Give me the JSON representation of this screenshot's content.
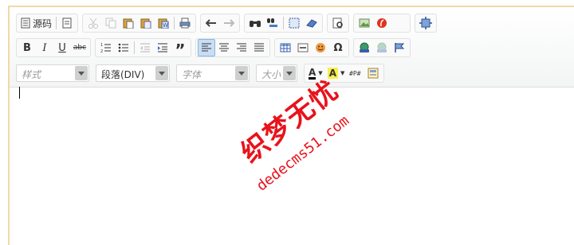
{
  "toolbar": {
    "source_label": "源码",
    "paragraph_format": "段落(DIV)",
    "style_placeholder": "样式",
    "font_placeholder": "字体",
    "size_placeholder": "大小",
    "bold": "B",
    "italic": "I",
    "underline": "U",
    "strike": "abc",
    "quote": "”",
    "omega": "Ω",
    "font_color_letter": "A",
    "bg_color_letter": "A"
  },
  "watermark": {
    "cn_text": "织梦无忧",
    "en_text": "dedecms51.com"
  },
  "colors": {
    "accent": "#e8121b",
    "border": "#f1d9a6",
    "active": "#c9def4"
  }
}
